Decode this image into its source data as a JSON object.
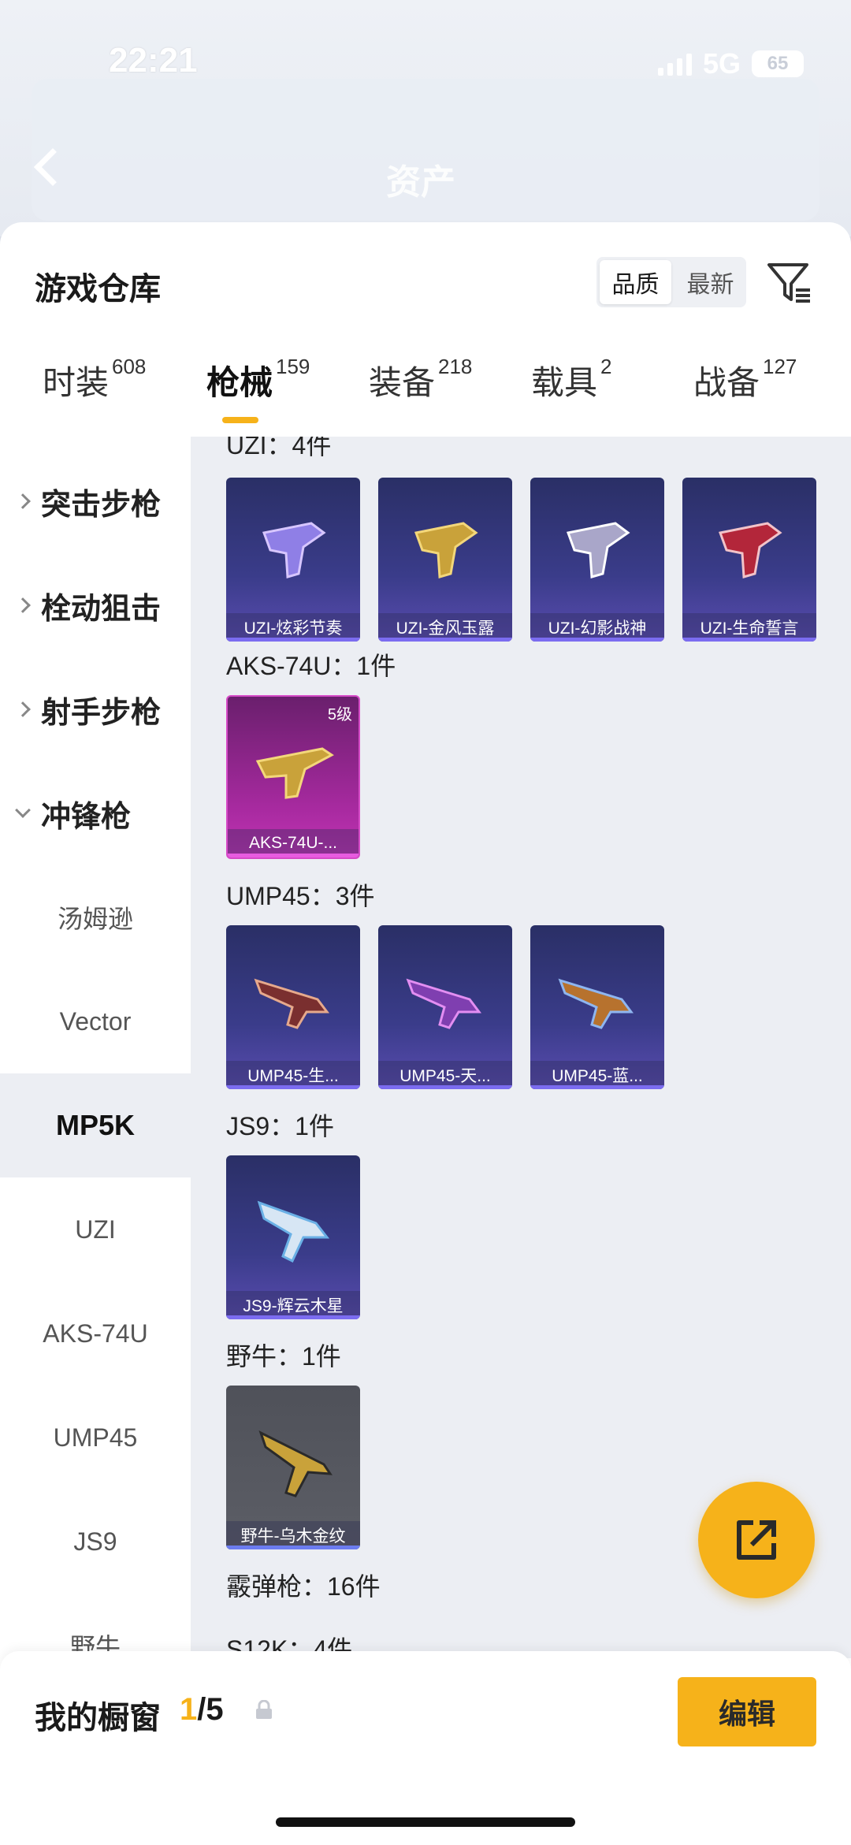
{
  "status": {
    "time": "22:21",
    "network": "5G",
    "battery": "65"
  },
  "nav": {
    "title": "资产"
  },
  "sheet": {
    "title": "游戏仓库",
    "sort": [
      "品质",
      "最新"
    ],
    "tabs": [
      {
        "label": "时装",
        "count": "608"
      },
      {
        "label": "枪械",
        "count": "159"
      },
      {
        "label": "装备",
        "count": "218"
      },
      {
        "label": "载具",
        "count": "2"
      },
      {
        "label": "战备",
        "count": "127"
      }
    ]
  },
  "sidebar": {
    "categories": [
      "突击步枪",
      "栓动狙击",
      "射手步枪",
      "冲锋枪"
    ],
    "subs": [
      "汤姆逊",
      "Vector",
      "MP5K",
      "UZI",
      "AKS-74U",
      "UMP45",
      "JS9",
      "野牛"
    ]
  },
  "groups": [
    {
      "label": "UZI：4件",
      "items": [
        "UZI-炫彩节奏",
        "UZI-金风玉露",
        "UZI-幻影战神",
        "UZI-生命誓言"
      ]
    },
    {
      "label": "AKS-74U：1件",
      "items": [
        "AKS-74U-..."
      ],
      "level": "5级"
    },
    {
      "label": "UMP45：3件",
      "items": [
        "UMP45-生...",
        "UMP45-天...",
        "UMP45-蓝..."
      ]
    },
    {
      "label": "JS9：1件",
      "items": [
        "JS9-辉云木星"
      ]
    },
    {
      "label": "野牛：1件",
      "items": [
        "野牛-乌木金纹"
      ]
    },
    {
      "label": "霰弹枪：16件",
      "items": []
    },
    {
      "label": "S12K：4件",
      "items": []
    }
  ],
  "bottom": {
    "title": "我的橱窗",
    "current": "1",
    "total": "/5",
    "edit": "编辑"
  },
  "colors": {
    "accent": "#f6b21a",
    "card_purple": "#3a3c8a",
    "card_pink": "#a82aa0"
  }
}
